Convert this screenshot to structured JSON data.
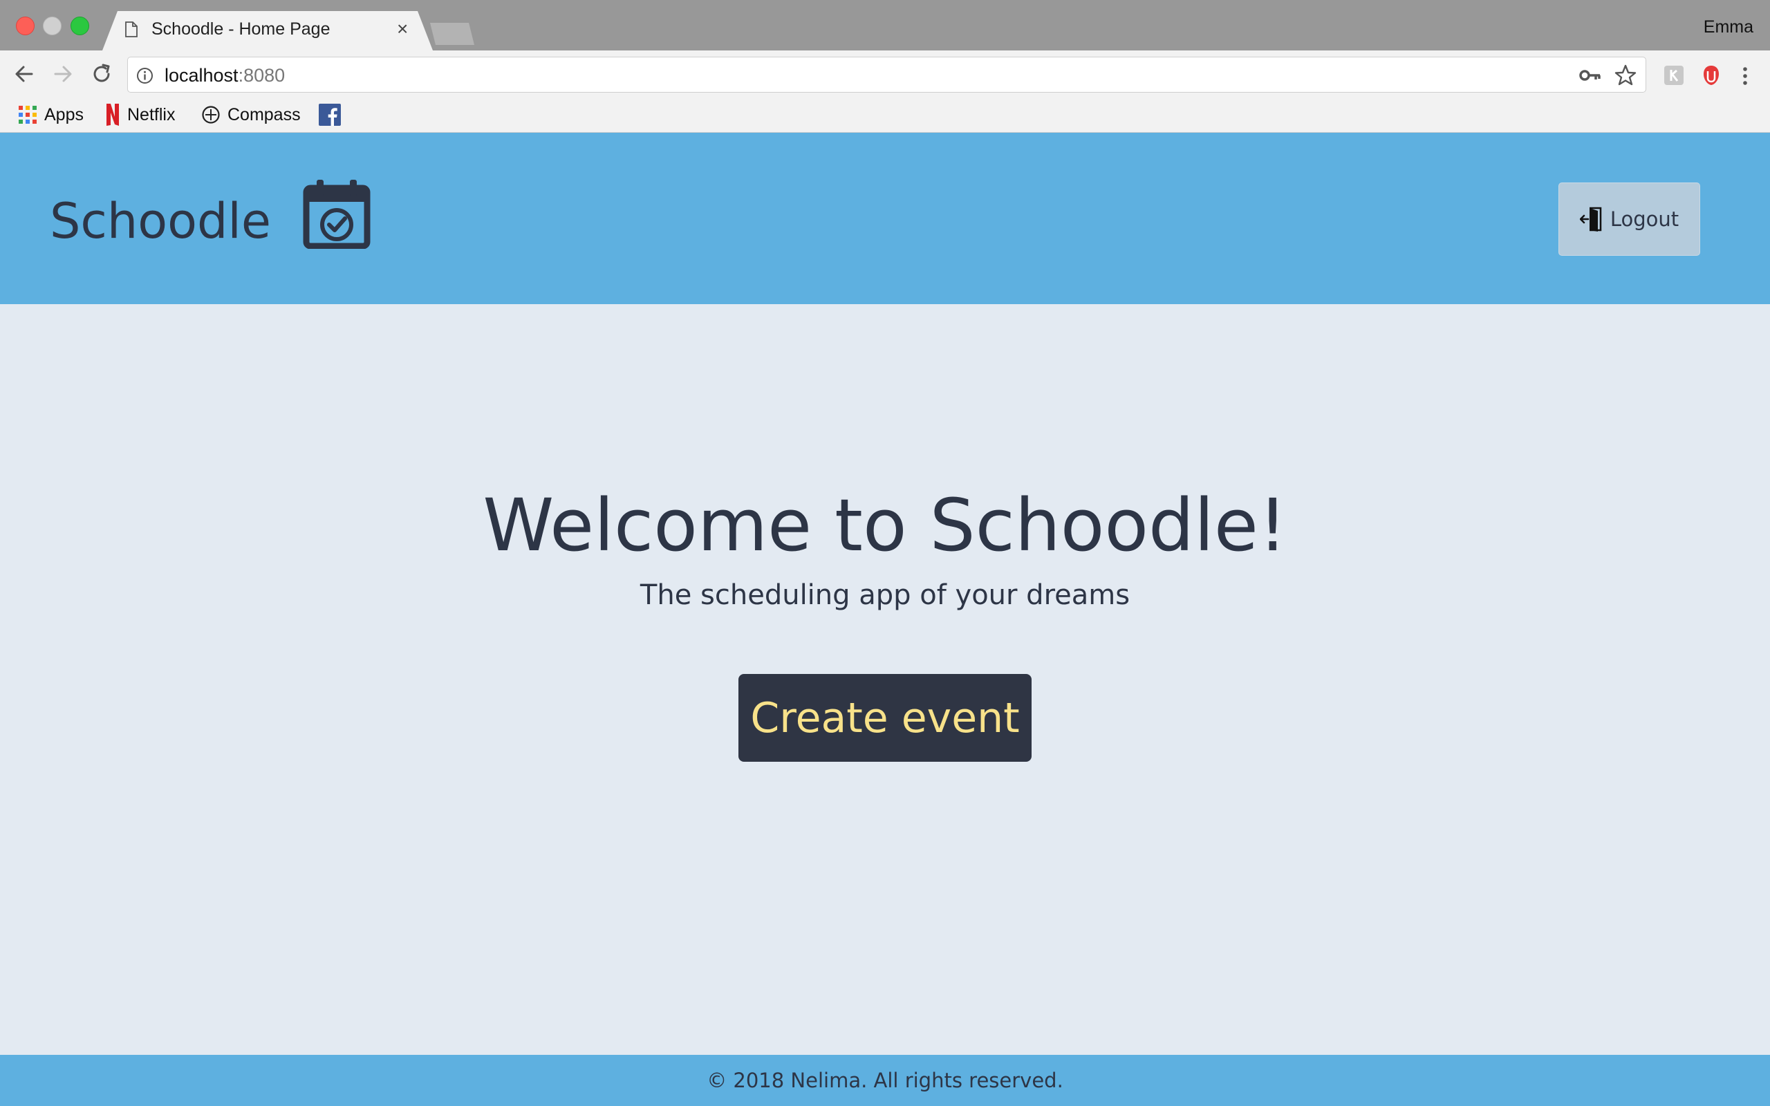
{
  "browser": {
    "tab": {
      "title": "Schoodle - Home Page",
      "close_glyph": "×",
      "icon": "document-icon"
    },
    "profile_name": "Emma",
    "address": {
      "host": "localhost",
      "port": ":8080"
    },
    "bookmarks": [
      {
        "label": "Apps",
        "icon": "apps-grid-icon"
      },
      {
        "label": "Netflix",
        "icon": "netflix-icon"
      },
      {
        "label": "Compass",
        "icon": "compass-icon"
      },
      {
        "label": "",
        "icon": "facebook-icon"
      }
    ]
  },
  "header": {
    "brand": "Schoodle",
    "brand_icon": "calendar-check-icon",
    "logout_label": "Logout",
    "logout_icon": "door-exit-icon"
  },
  "hero": {
    "title": "Welcome to Schoodle!",
    "subtitle": "The scheduling app of your dreams",
    "cta_label": "Create event"
  },
  "footer": {
    "text": "© 2018 Nelima. All rights reserved."
  },
  "colors": {
    "header_bg": "#5eb0e0",
    "page_bg": "#e3eaf2",
    "text_dark": "#2d3546",
    "cta_bg": "#2f3544",
    "cta_text": "#f8e28a",
    "logout_bg": "#b4cbdc"
  }
}
